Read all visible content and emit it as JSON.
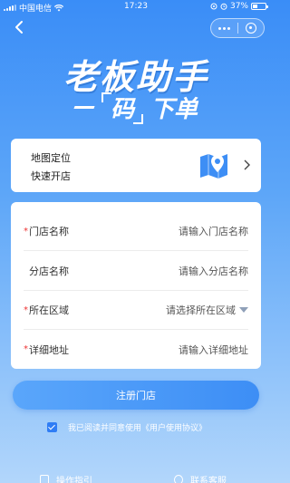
{
  "status_bar": {
    "carrier": "中国电信",
    "time": "17:23",
    "battery": "37%"
  },
  "hero": {
    "title": "老板助手",
    "sub_pre": "一",
    "sub_code": "码",
    "sub_post": "下单"
  },
  "map_card": {
    "line1": "地图定位",
    "line2": "快速开店",
    "icon": "map-pin-icon"
  },
  "form": {
    "fields": [
      {
        "label": "门店名称",
        "required": true,
        "placeholder": "请输入门店名称",
        "type": "input"
      },
      {
        "label": "分店名称",
        "required": false,
        "placeholder": "请输入分店名称",
        "type": "input"
      },
      {
        "label": "所在区域",
        "required": true,
        "placeholder": "请选择所在区域",
        "type": "select"
      },
      {
        "label": "详细地址",
        "required": true,
        "placeholder": "请输入详细地址",
        "type": "input"
      }
    ]
  },
  "register_button": "注册门店",
  "agreement": {
    "checked": true,
    "text": "我已阅读并同意使用《用户使用协议》"
  },
  "footer": {
    "left": "操作指引",
    "right": "联系客服"
  },
  "colors": {
    "accent": "#3d8ef5",
    "required": "#e33333",
    "background_top": "#3a8df7"
  }
}
